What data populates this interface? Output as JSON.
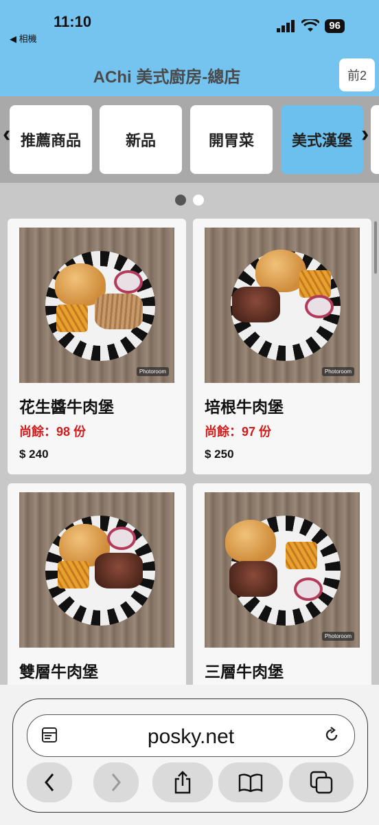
{
  "status_bar": {
    "time": "11:10",
    "back_app": "◀ 相機",
    "battery": "96"
  },
  "header": {
    "title": "AChi 美式廚房-總店",
    "page_button": "前2"
  },
  "categories": [
    {
      "label": "推薦商品",
      "active": false
    },
    {
      "label": "新品",
      "active": false
    },
    {
      "label": "開胃菜",
      "active": false
    },
    {
      "label": "美式漢堡",
      "active": true
    }
  ],
  "carousel": {
    "pages": 2,
    "current": 1
  },
  "products": [
    {
      "name": "花生醬牛肉堡",
      "stock": "尚餘：98 份",
      "price": "$ 240",
      "photo_badge": "Photoroom"
    },
    {
      "name": "培根牛肉堡",
      "stock": "尚餘：97 份",
      "price": "$ 250",
      "photo_badge": "Photoroom"
    },
    {
      "name": "雙層牛肉堡",
      "stock": "",
      "price": "",
      "photo_badge": ""
    },
    {
      "name": "三層牛肉堡",
      "stock": "",
      "price": "",
      "photo_badge": "Photoroom"
    }
  ],
  "browser": {
    "url": "posky.net"
  },
  "colors": {
    "header_bg": "#75c4f0",
    "active_category": "#6cc0ee",
    "stock_red": "#d11a1a"
  }
}
